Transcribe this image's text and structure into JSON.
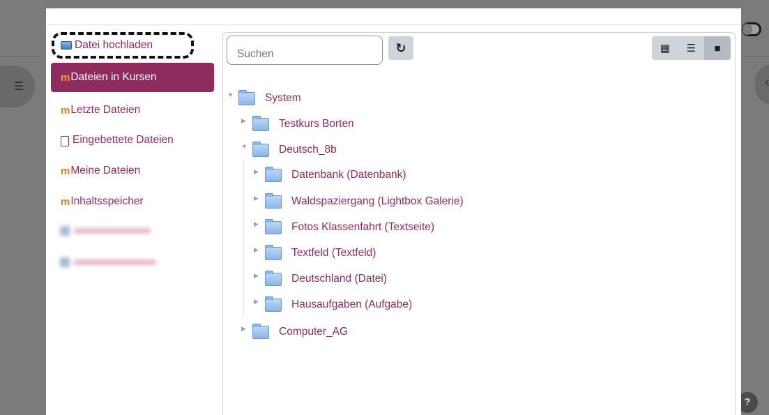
{
  "sidebar": {
    "items": [
      {
        "label": "Datei hochladen",
        "icon": "upload-icon"
      },
      {
        "label": "Dateien in Kursen",
        "icon": "moodle-icon",
        "active": true
      },
      {
        "label": "Letzte Dateien",
        "icon": "moodle-icon"
      },
      {
        "label": "Eingebettete Dateien",
        "icon": "document-icon"
      },
      {
        "label": "Meine Dateien",
        "icon": "moodle-icon"
      },
      {
        "label": "Inhaltsspeicher",
        "icon": "moodle-icon"
      }
    ]
  },
  "search": {
    "placeholder": "Suchen"
  },
  "toolbar": {
    "refresh_icon": "refresh-icon",
    "views": [
      "grid-view-icon",
      "list-view-icon",
      "tree-view-icon"
    ],
    "active_view": "tree-view-icon"
  },
  "tree": {
    "root": "System",
    "children": [
      {
        "label": "Testkurs Borten",
        "expanded": false
      },
      {
        "label": "Deutsch_8b",
        "expanded": true
      },
      {
        "label": "Computer_AG",
        "expanded": false
      }
    ],
    "deutsch_children": [
      "Datenbank (Datenbank)",
      "Waldspaziergang (Lightbox Galerie)",
      "Fotos Klassenfahrt (Textseite)",
      "Textfeld (Textfeld)",
      "Deutschland (Datei)",
      "Hausaufgaben (Aufgabe)"
    ]
  },
  "help": {
    "label": "?"
  },
  "colors": {
    "accent": "#8f2b5e",
    "moodle_orange": "#e5811a"
  }
}
